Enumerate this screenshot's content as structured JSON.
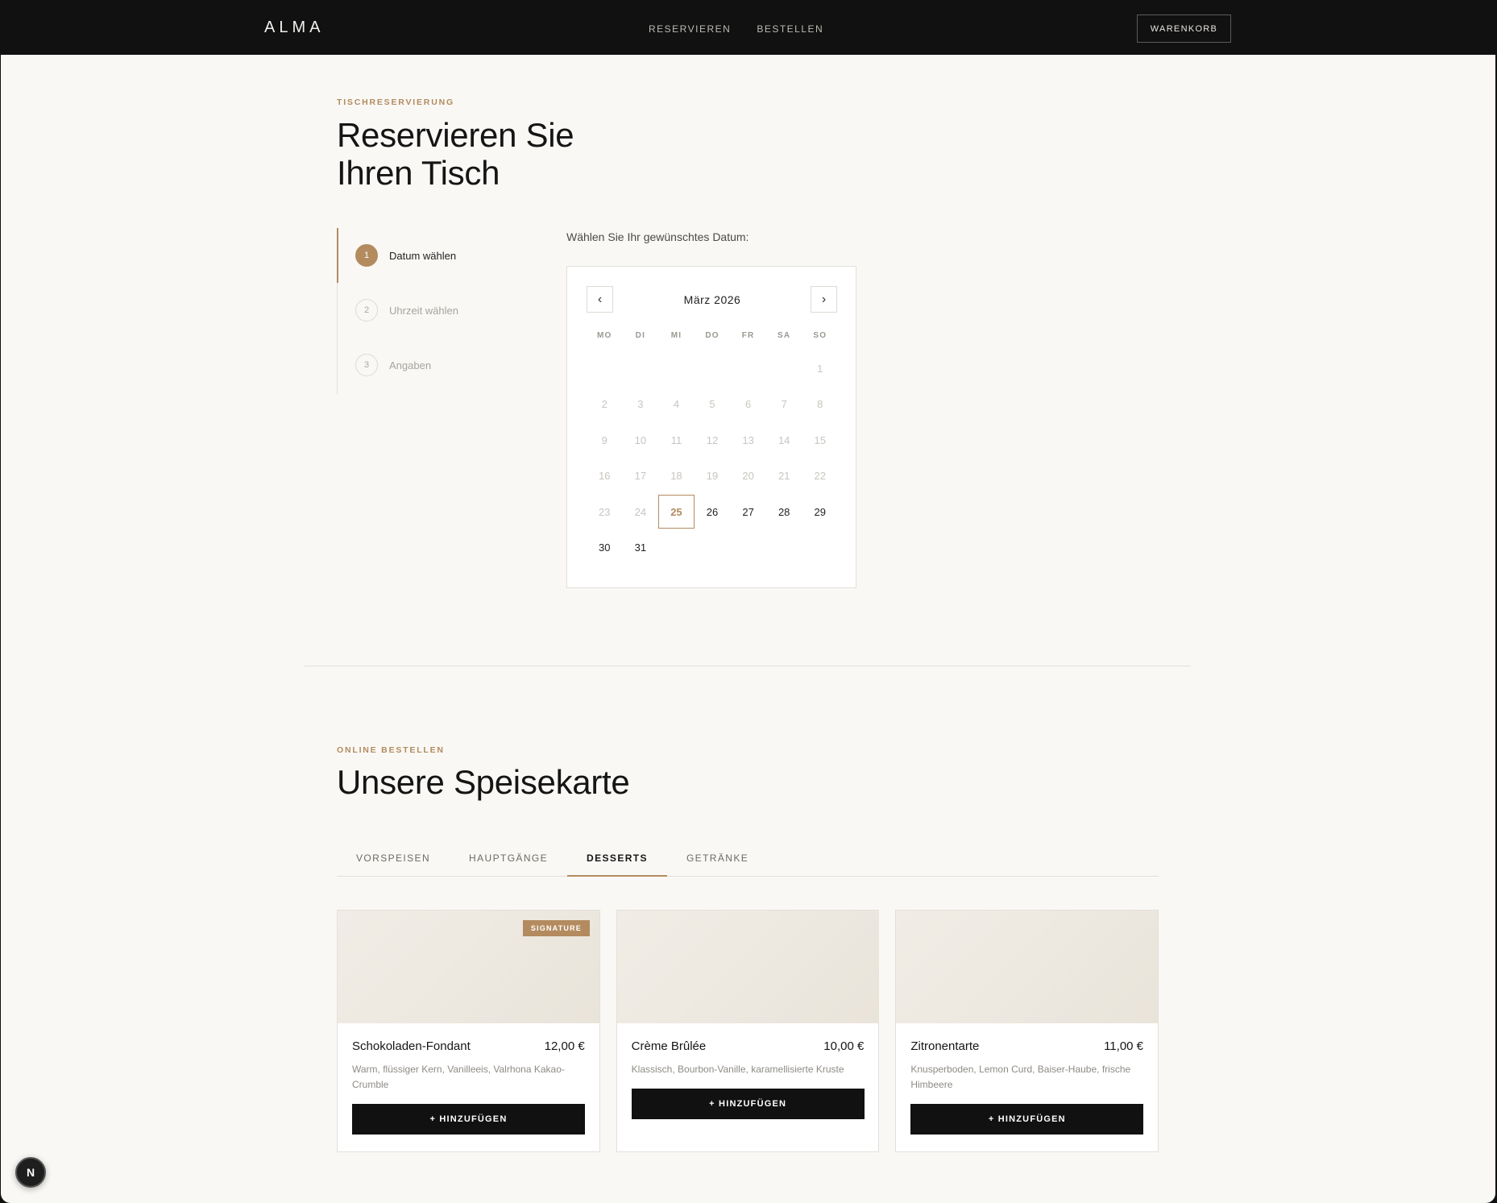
{
  "header": {
    "logo": "ALMA",
    "nav": [
      "RESERVIEREN",
      "BESTELLEN"
    ],
    "cart_label": "WARENKORB"
  },
  "reservation": {
    "eyebrow": "TISCHRESERVIERUNG",
    "title_line1": "Reservieren Sie",
    "title_line2": "Ihren Tisch",
    "steps": [
      {
        "num": "1",
        "label": "Datum wählen"
      },
      {
        "num": "2",
        "label": "Uhrzeit wählen"
      },
      {
        "num": "3",
        "label": "Angaben"
      }
    ],
    "active_step": 0,
    "date_prompt": "Wählen Sie Ihr gewünschtes Datum:",
    "calendar": {
      "prev_icon": "‹",
      "next_icon": "›",
      "month_label": "März 2026",
      "weekdays": [
        "MO",
        "DI",
        "MI",
        "DO",
        "FR",
        "SA",
        "SO"
      ],
      "leading_blanks": 6,
      "days_in_month": 31,
      "first_available_day": 25,
      "selected_day": 25
    }
  },
  "menu": {
    "eyebrow": "ONLINE BESTELLEN",
    "title": "Unsere Speisekarte",
    "tabs": [
      "VORSPEISEN",
      "HAUPTGÄNGE",
      "DESSERTS",
      "GETRÄNKE"
    ],
    "active_tab": 2,
    "items": [
      {
        "name": "Schokoladen-Fondant",
        "price": "12,00 €",
        "description": "Warm, flüssiger Kern, Vanilleeis, Valrhona Kakao-Crumble",
        "badge": "SIGNATURE",
        "button": "+ HINZUFÜGEN"
      },
      {
        "name": "Crème Brûlée",
        "price": "10,00 €",
        "description": "Klassisch, Bourbon-Vanille, karamellisierte Kruste",
        "badge": "",
        "button": "+ HINZUFÜGEN"
      },
      {
        "name": "Zitronentarte",
        "price": "11,00 €",
        "description": "Knusperboden, Lemon Curd, Baiser-Haube, frische Himbeere",
        "badge": "",
        "button": "+ HINZUFÜGEN"
      }
    ]
  },
  "dev_badge": "N",
  "colors": {
    "accent": "#b38b5f",
    "header_bg": "#111111",
    "page_bg": "#f9f8f5"
  }
}
